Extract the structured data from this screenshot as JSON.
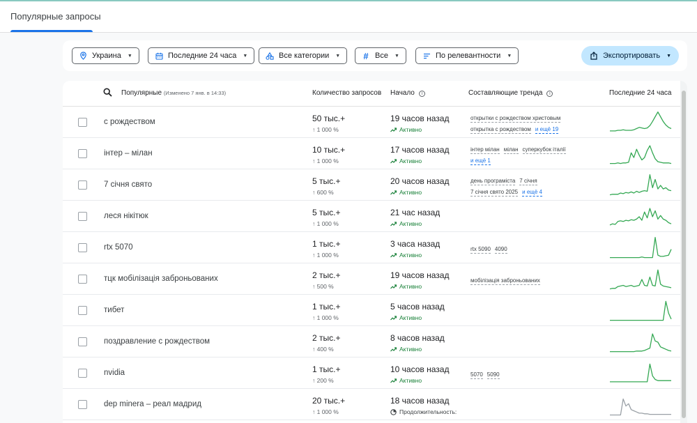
{
  "tab": {
    "label": "Популярные запросы"
  },
  "filters": {
    "location": "Украина",
    "period": "Последние 24 часа",
    "category": "Все категории",
    "status": "Все",
    "sort": "По релевантности",
    "export": "Экспортировать"
  },
  "table": {
    "headers": {
      "trending": "Популярные",
      "updated": "(Изменено 7 янв. в 14:33)",
      "volume": "Количество запросов",
      "start": "Начало",
      "breakdown": "Составляющие тренда",
      "last24": "Последние 24 часа"
    },
    "rows": [
      {
        "term": "с рождеством",
        "volume": "50 тыс.+",
        "change": "↑ 1 000 %",
        "start": "19 часов назад",
        "status": "Активно",
        "active": true,
        "tags": [
          "открытки с рождеством христовым",
          "открытка с рождеством"
        ],
        "more": "и ещё 19",
        "spark": [
          6,
          6,
          6,
          7,
          7,
          8,
          7,
          7,
          7,
          8,
          10,
          12,
          11,
          10,
          11,
          15,
          22,
          30,
          38,
          30,
          22,
          16,
          12,
          10
        ]
      },
      {
        "term": "інтер – мілан",
        "volume": "10 тыс.+",
        "change": "↑ 1 000 %",
        "start": "17 часов назад",
        "status": "Активно",
        "active": true,
        "tags": [
          "інтер мілан",
          "мілан",
          "суперкубок італії"
        ],
        "more": "и ещё 1",
        "spark": [
          4,
          4,
          4,
          5,
          4,
          5,
          5,
          6,
          22,
          14,
          28,
          18,
          10,
          14,
          26,
          34,
          22,
          12,
          7,
          6,
          5,
          5,
          5,
          4
        ]
      },
      {
        "term": "7 січня свято",
        "volume": "5 тыс.+",
        "change": "↑ 600 %",
        "start": "20 часов назад",
        "status": "Активно",
        "active": true,
        "tags": [
          "день програміста",
          "7 січня",
          "7 січня свято 2025"
        ],
        "more": "и ещё 4",
        "spark": [
          4,
          5,
          5,
          5,
          7,
          6,
          8,
          7,
          9,
          7,
          10,
          8,
          10,
          11,
          10,
          38,
          16,
          30,
          14,
          20,
          14,
          16,
          12,
          11
        ]
      },
      {
        "term": "леся нікітюк",
        "volume": "5 тыс.+",
        "change": "↑ 1 000 %",
        "start": "21 час назад",
        "status": "Активно",
        "active": true,
        "tags": [],
        "more": "",
        "spark": [
          6,
          8,
          7,
          12,
          13,
          12,
          14,
          13,
          15,
          14,
          16,
          20,
          14,
          28,
          18,
          34,
          20,
          30,
          16,
          22,
          16,
          14,
          10,
          8
        ]
      },
      {
        "term": "rtx 5070",
        "volume": "1 тыс.+",
        "change": "↑ 1 000 %",
        "start": "3 часа назад",
        "status": "Активно",
        "active": true,
        "tags": [
          "rtx 5090",
          "4090"
        ],
        "more": "",
        "spark": [
          4,
          4,
          4,
          4,
          4,
          4,
          4,
          4,
          4,
          4,
          4,
          4,
          5,
          4,
          4,
          4,
          4,
          38,
          8,
          6,
          6,
          7,
          8,
          18
        ]
      },
      {
        "term": "тцк мобілізація заброньованих",
        "volume": "2 тыс.+",
        "change": "↑ 500 %",
        "start": "19 часов назад",
        "status": "Активно",
        "active": true,
        "tags": [
          "мобілізація заброньованих"
        ],
        "more": "",
        "spark": [
          4,
          5,
          5,
          8,
          9,
          10,
          8,
          9,
          10,
          8,
          9,
          10,
          20,
          10,
          9,
          24,
          10,
          9,
          36,
          12,
          9,
          8,
          7,
          6
        ]
      },
      {
        "term": "тибет",
        "volume": "1 тыс.+",
        "change": "↑ 1 000 %",
        "start": "5 часов назад",
        "status": "Активно",
        "active": true,
        "tags": [],
        "more": "",
        "spark": [
          4,
          4,
          4,
          4,
          4,
          4,
          4,
          4,
          4,
          4,
          4,
          4,
          4,
          4,
          4,
          4,
          4,
          4,
          4,
          4,
          4,
          36,
          16,
          6
        ]
      },
      {
        "term": "поздравление с рождеством",
        "volume": "2 тыс.+",
        "change": "↑ 400 %",
        "start": "8 часов назад",
        "status": "Активно",
        "active": true,
        "tags": [],
        "more": "",
        "spark": [
          4,
          4,
          4,
          4,
          4,
          4,
          4,
          4,
          4,
          4,
          5,
          5,
          5,
          6,
          8,
          10,
          34,
          22,
          20,
          12,
          10,
          8,
          6,
          5
        ]
      },
      {
        "term": "nvidia",
        "volume": "1 тыс.+",
        "change": "↑ 200 %",
        "start": "10 часов назад",
        "status": "Активно",
        "active": true,
        "tags": [
          "5070",
          "5090"
        ],
        "more": "",
        "spark": [
          6,
          6,
          6,
          6,
          6,
          6,
          6,
          6,
          6,
          6,
          6,
          6,
          6,
          6,
          6,
          36,
          16,
          10,
          8,
          8,
          8,
          8,
          8,
          8
        ]
      },
      {
        "term": "dep minera – реал мадрид",
        "volume": "20 тыс.+",
        "change": "↑ 1 000 %",
        "start": "18 часов назад",
        "status": "Продолжительность: ",
        "active": false,
        "tags": [],
        "more": "",
        "spark": [
          3,
          3,
          3,
          3,
          3,
          30,
          18,
          22,
          12,
          10,
          8,
          6,
          6,
          5,
          5,
          4,
          4,
          4,
          4,
          4,
          4,
          4,
          4,
          4
        ]
      }
    ]
  },
  "colors": {
    "accent": "#1a73e8",
    "spark_active": "#34a853",
    "spark_inactive": "#9aa0a6",
    "export_bg": "#c2e7ff"
  }
}
